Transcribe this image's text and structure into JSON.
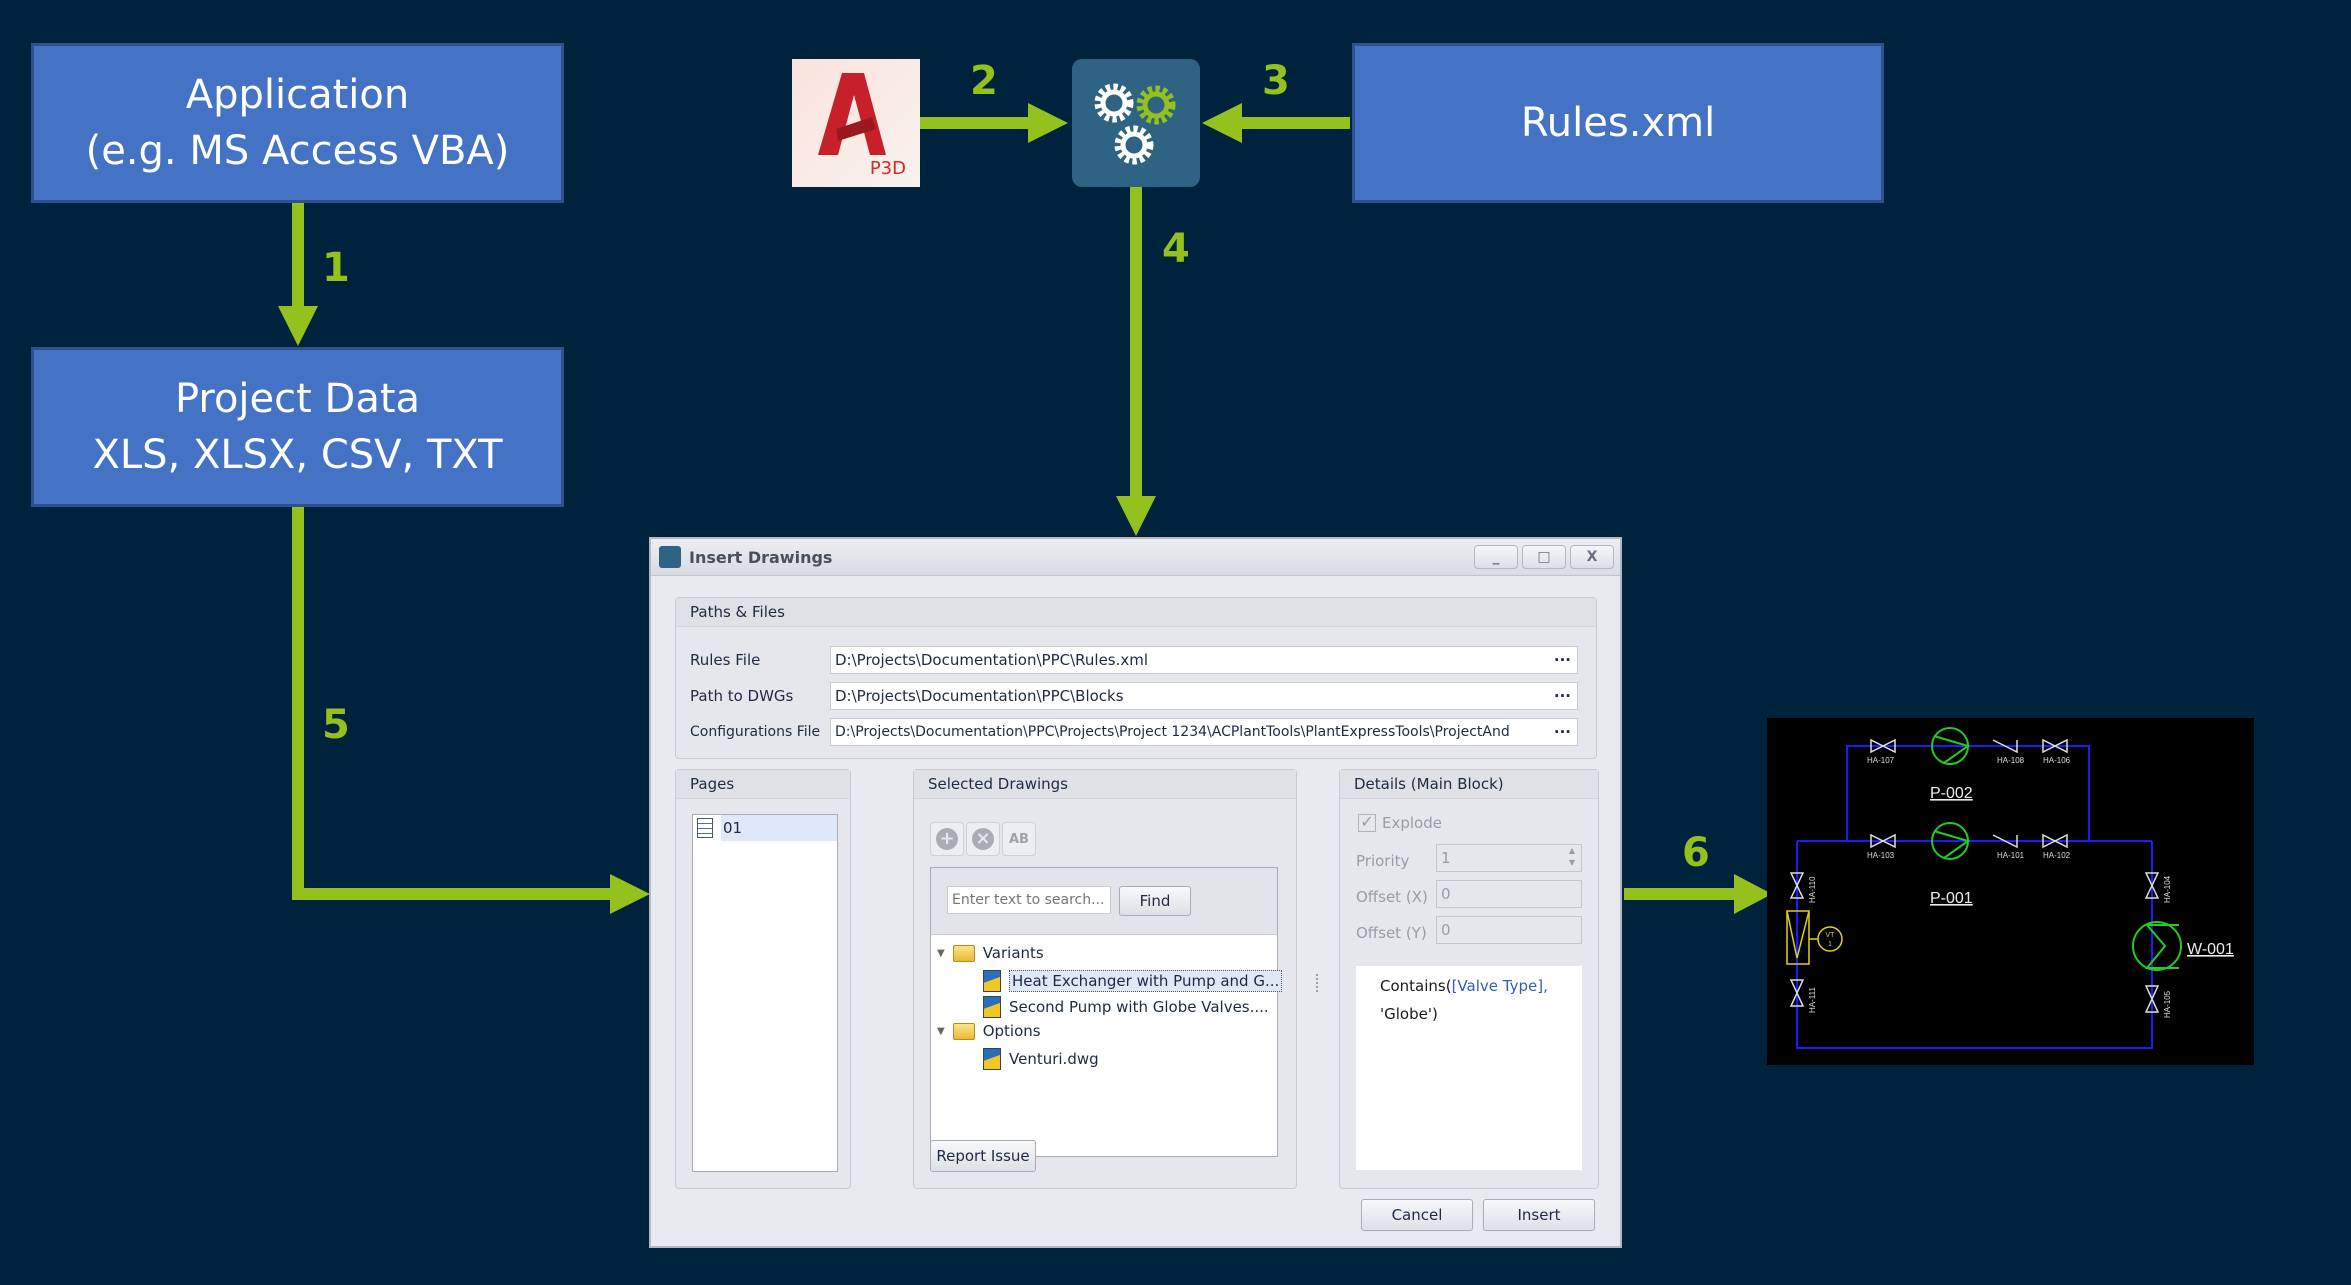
{
  "boxes": {
    "application": {
      "line1": "Application",
      "line2": "(e.g. MS Access VBA)"
    },
    "project_data": {
      "line1": "Project Data",
      "line2": "XLS, XLSX, CSV, TXT"
    },
    "rules": {
      "label": "Rules.xml"
    }
  },
  "icons": {
    "p3d_label": "P3D"
  },
  "steps": [
    "1",
    "2",
    "3",
    "4",
    "5",
    "6"
  ],
  "colors": {
    "background": "#00233d",
    "box": "#4472c4",
    "arrow": "#95c11f",
    "gear_tile": "#2e6384"
  },
  "dialog": {
    "title": "Insert Drawings",
    "window_buttons": {
      "minimize": "_",
      "maximize": "□",
      "close": "X"
    },
    "paths_group": {
      "title": "Paths & Files",
      "rows": [
        {
          "label": "Rules File",
          "value": "D:\\Projects\\Documentation\\PPC\\Rules.xml",
          "browse": "···"
        },
        {
          "label": "Path to DWGs",
          "value": "D:\\Projects\\Documentation\\PPC\\Blocks",
          "browse": "···"
        },
        {
          "label": "Configurations File",
          "value": "D:\\Projects\\Documentation\\PPC\\Projects\\Project 1234\\ACPlantTools\\PlantExpressTools\\ProjectAnd",
          "browse": "···"
        }
      ]
    },
    "pages": {
      "title": "Pages",
      "items": [
        "01"
      ]
    },
    "selected": {
      "title": "Selected Drawings",
      "search_placeholder": "Enter text to search...",
      "find_label": "Find",
      "rename_icon_text": "AB",
      "tree": {
        "variants": {
          "label": "Variants",
          "children": [
            "Heat Exchanger with Pump and G...",
            "Second Pump with Globe Valves...."
          ]
        },
        "options": {
          "label": "Options",
          "children": [
            "Venturi.dwg"
          ]
        }
      },
      "report_label": "Report Issue"
    },
    "details": {
      "title": "Details (Main Block)",
      "explode_label": "Explode",
      "explode_checked": true,
      "priority_label": "Priority",
      "priority_value": "1",
      "offset_x_label": "Offset (X)",
      "offset_x_value": "0",
      "offset_y_label": "Offset (Y)",
      "offset_y_value": "0",
      "expr_func": "Contains(",
      "expr_field": "[Valve Type],",
      "expr_arg": "'Globe')"
    },
    "cancel_label": "Cancel",
    "insert_label": "Insert"
  },
  "pid": {
    "pumps": [
      "P-002",
      "P-001"
    ],
    "exchanger": "W-001",
    "instrument": {
      "line1": "VT",
      "line2": "1"
    },
    "valves_top": [
      "HA-107",
      "HA-108",
      "HA-106"
    ],
    "valves_mid": [
      "HA-103",
      "HA-101",
      "HA-102"
    ],
    "valves_left": [
      "HA-110",
      "HA-111"
    ],
    "valves_right": [
      "HA-104",
      "HA-105"
    ]
  }
}
